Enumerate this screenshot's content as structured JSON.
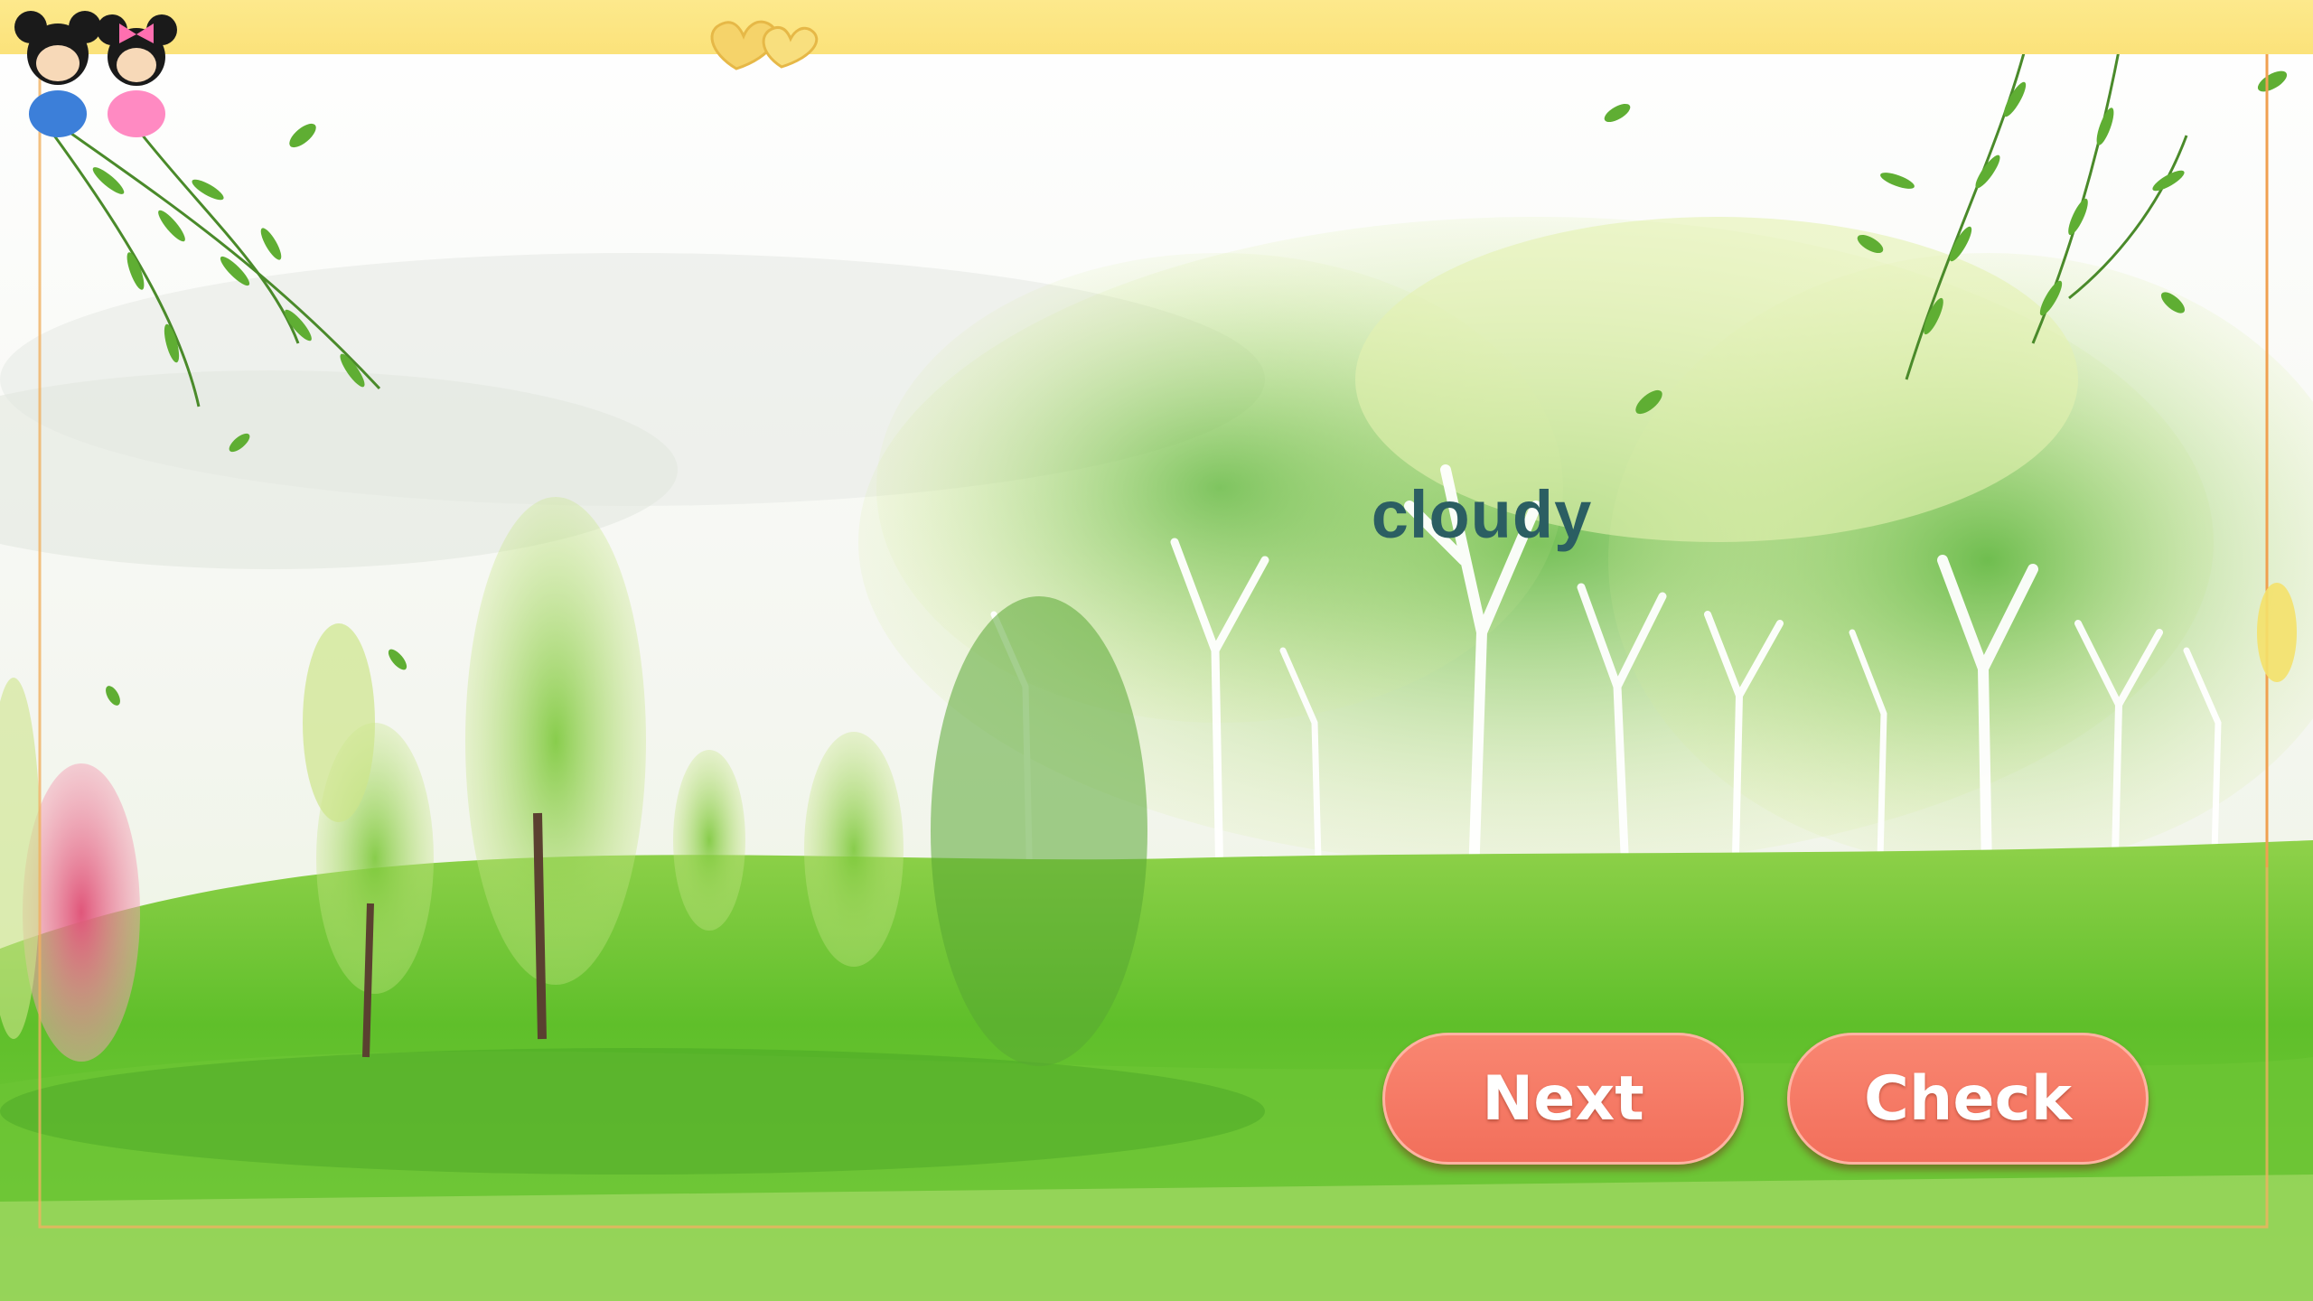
{
  "slide": {
    "word": "cloudy",
    "buttons": {
      "next_label": "Next",
      "check_label": "Check"
    }
  },
  "colors": {
    "word_text": "#2b5e62",
    "button_fill": "#f47862",
    "button_text": "#ffffff",
    "frame": "#fbe27a",
    "grass": "#5fbf2a"
  },
  "icons": {
    "corner_character": "mickey-minnie-icon",
    "frame_ornament": "hearts-ornament-icon"
  }
}
